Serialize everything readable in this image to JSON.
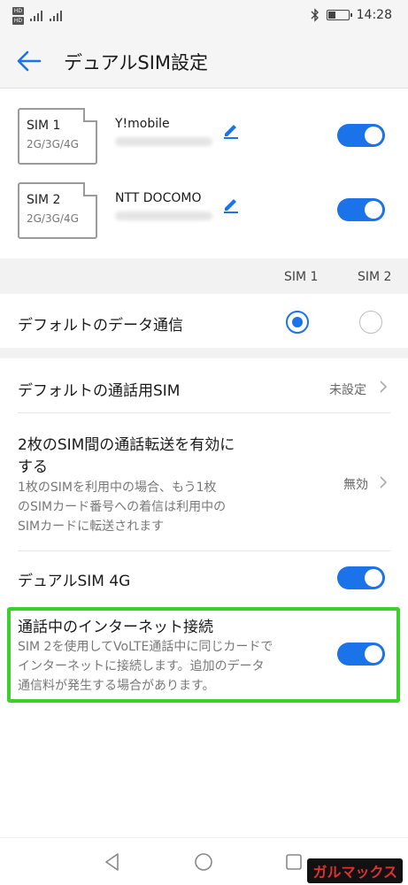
{
  "status_bar": {
    "hd_badge": "HD",
    "time": "14:28",
    "icons": [
      "hd-icon",
      "signal-icon",
      "bluetooth-icon",
      "battery-icon"
    ],
    "battery_level_pct": 40
  },
  "header": {
    "title": "デュアルSIM設定",
    "back_icon": "back-arrow-icon"
  },
  "sims": [
    {
      "slot": "SIM 1",
      "bands": "2G/3G/4G",
      "carrier": "Y!mobile",
      "enabled": true
    },
    {
      "slot": "SIM 2",
      "bands": "2G/3G/4G",
      "carrier": "NTT DOCOMO",
      "enabled": true
    }
  ],
  "sim_columns": [
    "SIM 1",
    "SIM 2"
  ],
  "default_data": {
    "label": "デフォルトのデータ通信",
    "selected": "SIM 1"
  },
  "default_call": {
    "label": "デフォルトの通話用SIM",
    "value": "未設定"
  },
  "call_forward": {
    "label_line1": "2枚のSIM間の通話転送を有効に",
    "label_line2": "する",
    "desc_line1": "1枚のSIMを利用中の場合、もう1枚",
    "desc_line2": "のSIMカード番号への着信は利用中の",
    "desc_line3": "SIMカードに転送されます",
    "value": "無効"
  },
  "dual_4g": {
    "label": "デュアルSIM 4G",
    "enabled": true
  },
  "internet_during_call": {
    "label": "通話中のインターネット接続",
    "desc_line1": "SIM 2を使用してVoLTE通話中に同じカードで",
    "desc_line2": "インターネットに接続します。追加のデータ",
    "desc_line3": "通信料が発生する場合があります。",
    "enabled": true
  },
  "colors": {
    "accent": "#1a73e8",
    "highlight": "#3ad12a"
  },
  "watermark": "ガルマックス"
}
